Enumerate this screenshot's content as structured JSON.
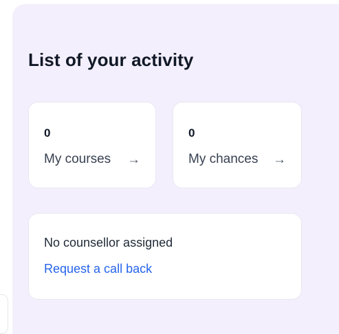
{
  "activity": {
    "title": "List of your activity",
    "cards": [
      {
        "count": "0",
        "label": "My courses",
        "arrow_icon": "arrow-right-icon"
      },
      {
        "count": "0",
        "label": "My chances",
        "arrow_icon": "arrow-right-icon"
      }
    ],
    "counsellor": {
      "status": "No counsellor assigned",
      "cta": "Request a call back"
    }
  },
  "colors": {
    "panel_background": "#f4effc",
    "card_background": "#ffffff",
    "title_text": "#111827",
    "link": "#2563eb"
  }
}
